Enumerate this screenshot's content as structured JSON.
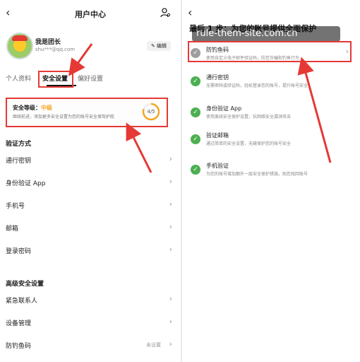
{
  "left": {
    "title": "用户中心",
    "profile": {
      "name": "我是团长",
      "email": "shu***@qq.com",
      "edit_label": "编辑"
    },
    "tabs": [
      {
        "label": "个人资料"
      },
      {
        "label": "安全设置"
      },
      {
        "label": "偏好设置"
      }
    ],
    "security": {
      "label": "安全等级：",
      "level": "中级",
      "desc": "继续前进，添加更多安全设置为您的账号安全保驾护航",
      "score": "4/5",
      "score_fraction": 0.8
    },
    "verify_section": "验证方式",
    "verify_items": [
      {
        "label": "通行密钥"
      },
      {
        "label": "身份验证 App"
      },
      {
        "label": "手机号"
      },
      {
        "label": "邮箱"
      },
      {
        "label": "登录密码"
      }
    ],
    "advanced_section": "高级安全设置",
    "advanced_items": [
      {
        "label": "紧急联系人",
        "status": ""
      },
      {
        "label": "设备管理",
        "status": ""
      },
      {
        "label": "防钓鱼码",
        "status": "未设置"
      }
    ]
  },
  "right": {
    "title": "最后 1 步：为您的账号提供全面保护",
    "items": [
      {
        "name": "防钓鱼码",
        "desc": "使用自定义电子邮件验证码，防范诈骗和钓鱼行为",
        "state": "pending"
      },
      {
        "name": "通行密钥",
        "desc": "无需密码或验证码，轻松登录您的账号，提升账号安全",
        "state": "done"
      },
      {
        "name": "身份验证 App",
        "desc": "使用离线安全保护设置，抗网络安全漏洞攻击",
        "state": "done"
      },
      {
        "name": "验证邮箱",
        "desc": "通过简单的安全设置，无缝保护您的账号安全",
        "state": "done"
      },
      {
        "name": "手机验证",
        "desc": "为您的账号增加额外一层安全保护措施，助您找回账号",
        "state": "done"
      }
    ]
  },
  "watermark": "rule-them-site.com.cn",
  "colors": {
    "annotation_red": "#e53935",
    "check_green": "#4caf50",
    "pending_gray": "#9e9e9e",
    "level_orange": "#f5a623"
  }
}
